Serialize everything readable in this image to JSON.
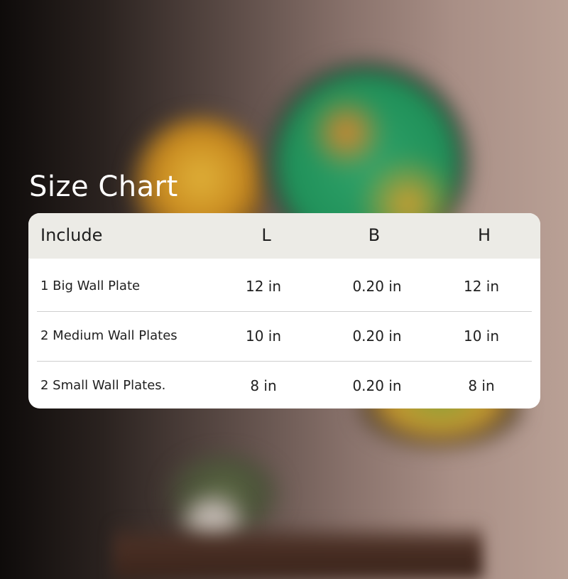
{
  "title": "Size Chart",
  "table": {
    "headers": [
      "Include",
      "L",
      "B",
      "H"
    ],
    "rows": [
      {
        "include": "1 Big Wall Plate",
        "l": "12 in",
        "b": "0.20 in",
        "h": "12 in"
      },
      {
        "include": "2 Medium Wall Plates",
        "l": "10 in",
        "b": "0.20 in",
        "h": "10 in"
      },
      {
        "include": "2 Small Wall Plates.",
        "l": "8 in",
        "b": "0.20 in",
        "h": "8 in"
      }
    ]
  }
}
